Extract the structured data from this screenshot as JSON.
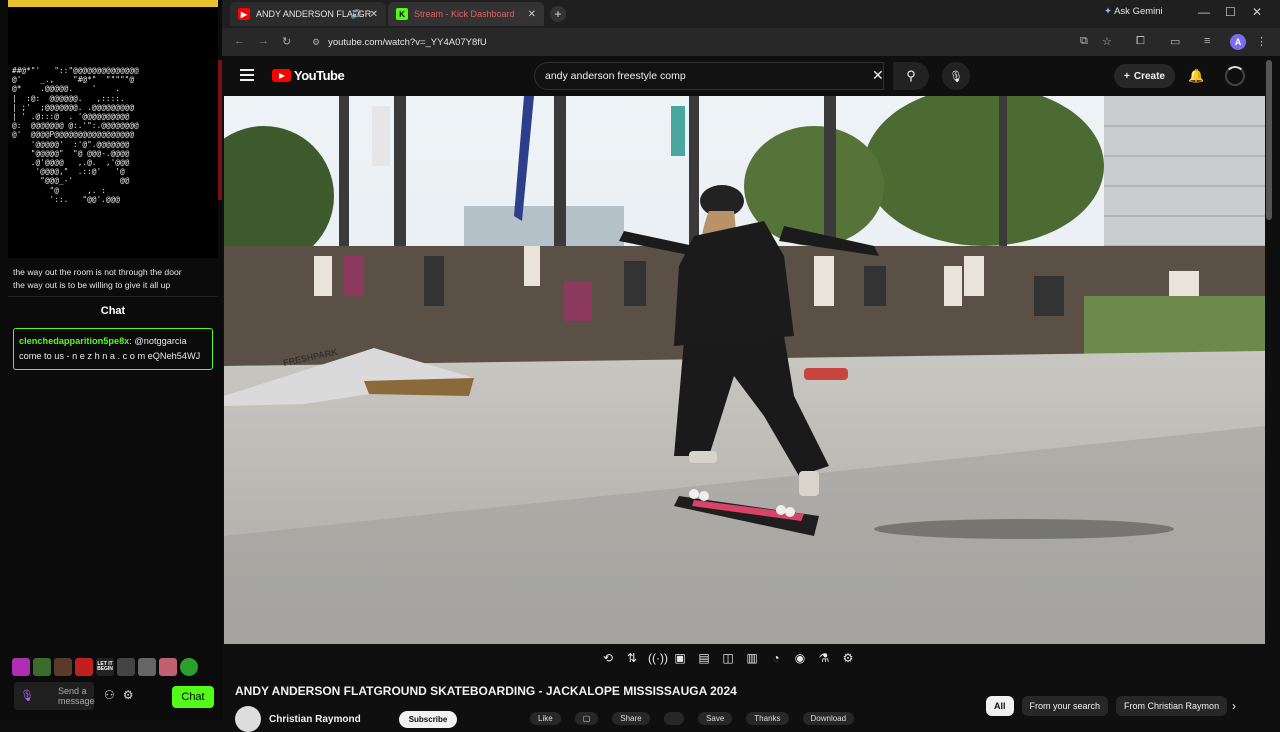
{
  "stream_panel": {
    "ascii_art": "##@*\"'   \"::\"@@@@@@@@@@@@@@\n@'    _.,    \"#@*\"  \"\"\"\"\"@\n@*    .@@@@@.    '    .\n|  :@:  @@@@@@.   ,::::.\n| ;'  ;@@@@@@@. .@@@@@@@@@\n| ' .@:::@  . '@@@@@@@@@@\n@:  @@@@@@@ @:.'\":.@@@@@@@@\n@'  @@@@P@@@@@@@@@@@@@@@@@\n    '@@@@@'  :'@\".@@@@@@@\n    \"@@@@@\"  \"@ @@@-.@@@@\n    .@'@@@@   ,.@.  ,'@@@\n     '@@@@,\"  .::@'   '@\n      \"@@@_-'          @@\n        \"@      ,. :\n        '::.   \"@@'.@@@",
    "poem_line1": "the way out the room is not through the door",
    "poem_line2": "the way out is to be willing to give it all up",
    "chat_header": "Chat",
    "message_user": "clenchedapparition5pe8x",
    "message_mention": ": @notggarcia",
    "message_body": "come to us - n e z h n a . c o m eQNeh54WJ",
    "emotes": [
      "emote-1",
      "emote-2",
      "emote-3",
      "emote-4",
      "LET IT BEGIN",
      "emote-6",
      "emote-7",
      "emote-8",
      "emote-9"
    ],
    "input_placeholder": "Send a message",
    "chat_button": "Chat"
  },
  "browser": {
    "tab1_title": "ANDY ANDERSON FLATGR",
    "tab2_title": "Stream - Kick Dashboard",
    "ask_gemini": "Ask Gemini",
    "url": "youtube.com/watch?v=_YY4A07Y8fU"
  },
  "youtube": {
    "logo_text": "YouTube",
    "search_query": "andy anderson freestyle comp",
    "create_label": "Create",
    "video_title": "ANDY ANDERSON FLATGROUND SKATEBOARDING - JACKALOPE MISSISSAUGA 2024",
    "channel_name": "Christian Raymond",
    "subscribe_label": "Subscribe",
    "actions": [
      "Like",
      "",
      "Share",
      "",
      "Save",
      "Thanks",
      "Download"
    ],
    "chips": [
      "All",
      "From your search",
      "From Christian Raymon"
    ],
    "video_text": {
      "ramp_brand": "FRESHPARK"
    }
  }
}
